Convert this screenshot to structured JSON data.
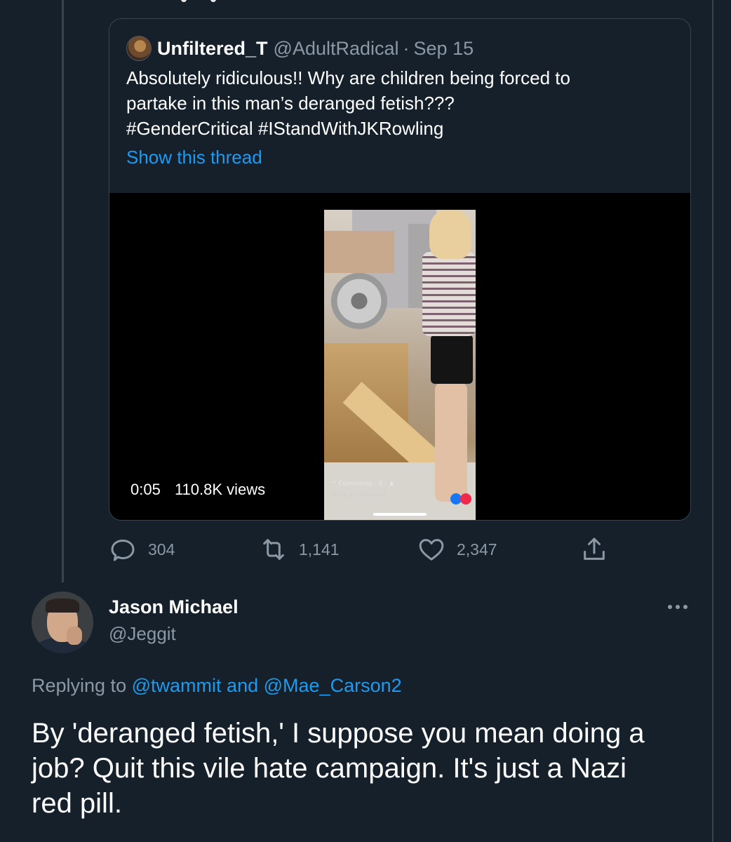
{
  "quoted_tweet": {
    "display_name": "Unfiltered_T",
    "handle": "@AdultRadical",
    "separator": "·",
    "date": "Sep 15",
    "text_lines": [
      "Absolutely ridiculous!! Why are children being forced to",
      "partake in this man’s deranged fetish???",
      "#GenderCritical #IStandWithJKRowling"
    ],
    "show_thread_label": "Show this thread",
    "video": {
      "duration": "0:05",
      "views": "110.8K views",
      "overlay_comments": "^  Comments · 1 · ♟",
      "overlay_input_placeholder": "Write a comment..."
    }
  },
  "actions": {
    "reply_count": "304",
    "retweet_count": "1,141",
    "like_count": "2,347"
  },
  "main_tweet": {
    "display_name": "Jason Michael",
    "handle": "@Jeggit",
    "replying_prefix": "Replying to",
    "mention_1": "@twammit",
    "mention_joiner": "and",
    "mention_2": "@Mae_Carson2",
    "text_lines": [
      "By 'deranged fetish,' I suppose you mean doing a",
      "job? Quit this vile hate campaign. It's just a Nazi",
      "red pill."
    ]
  },
  "colors": {
    "background": "#15202b",
    "border": "#38444d",
    "secondary_text": "#8b98a5",
    "link": "#1d9bf0"
  }
}
